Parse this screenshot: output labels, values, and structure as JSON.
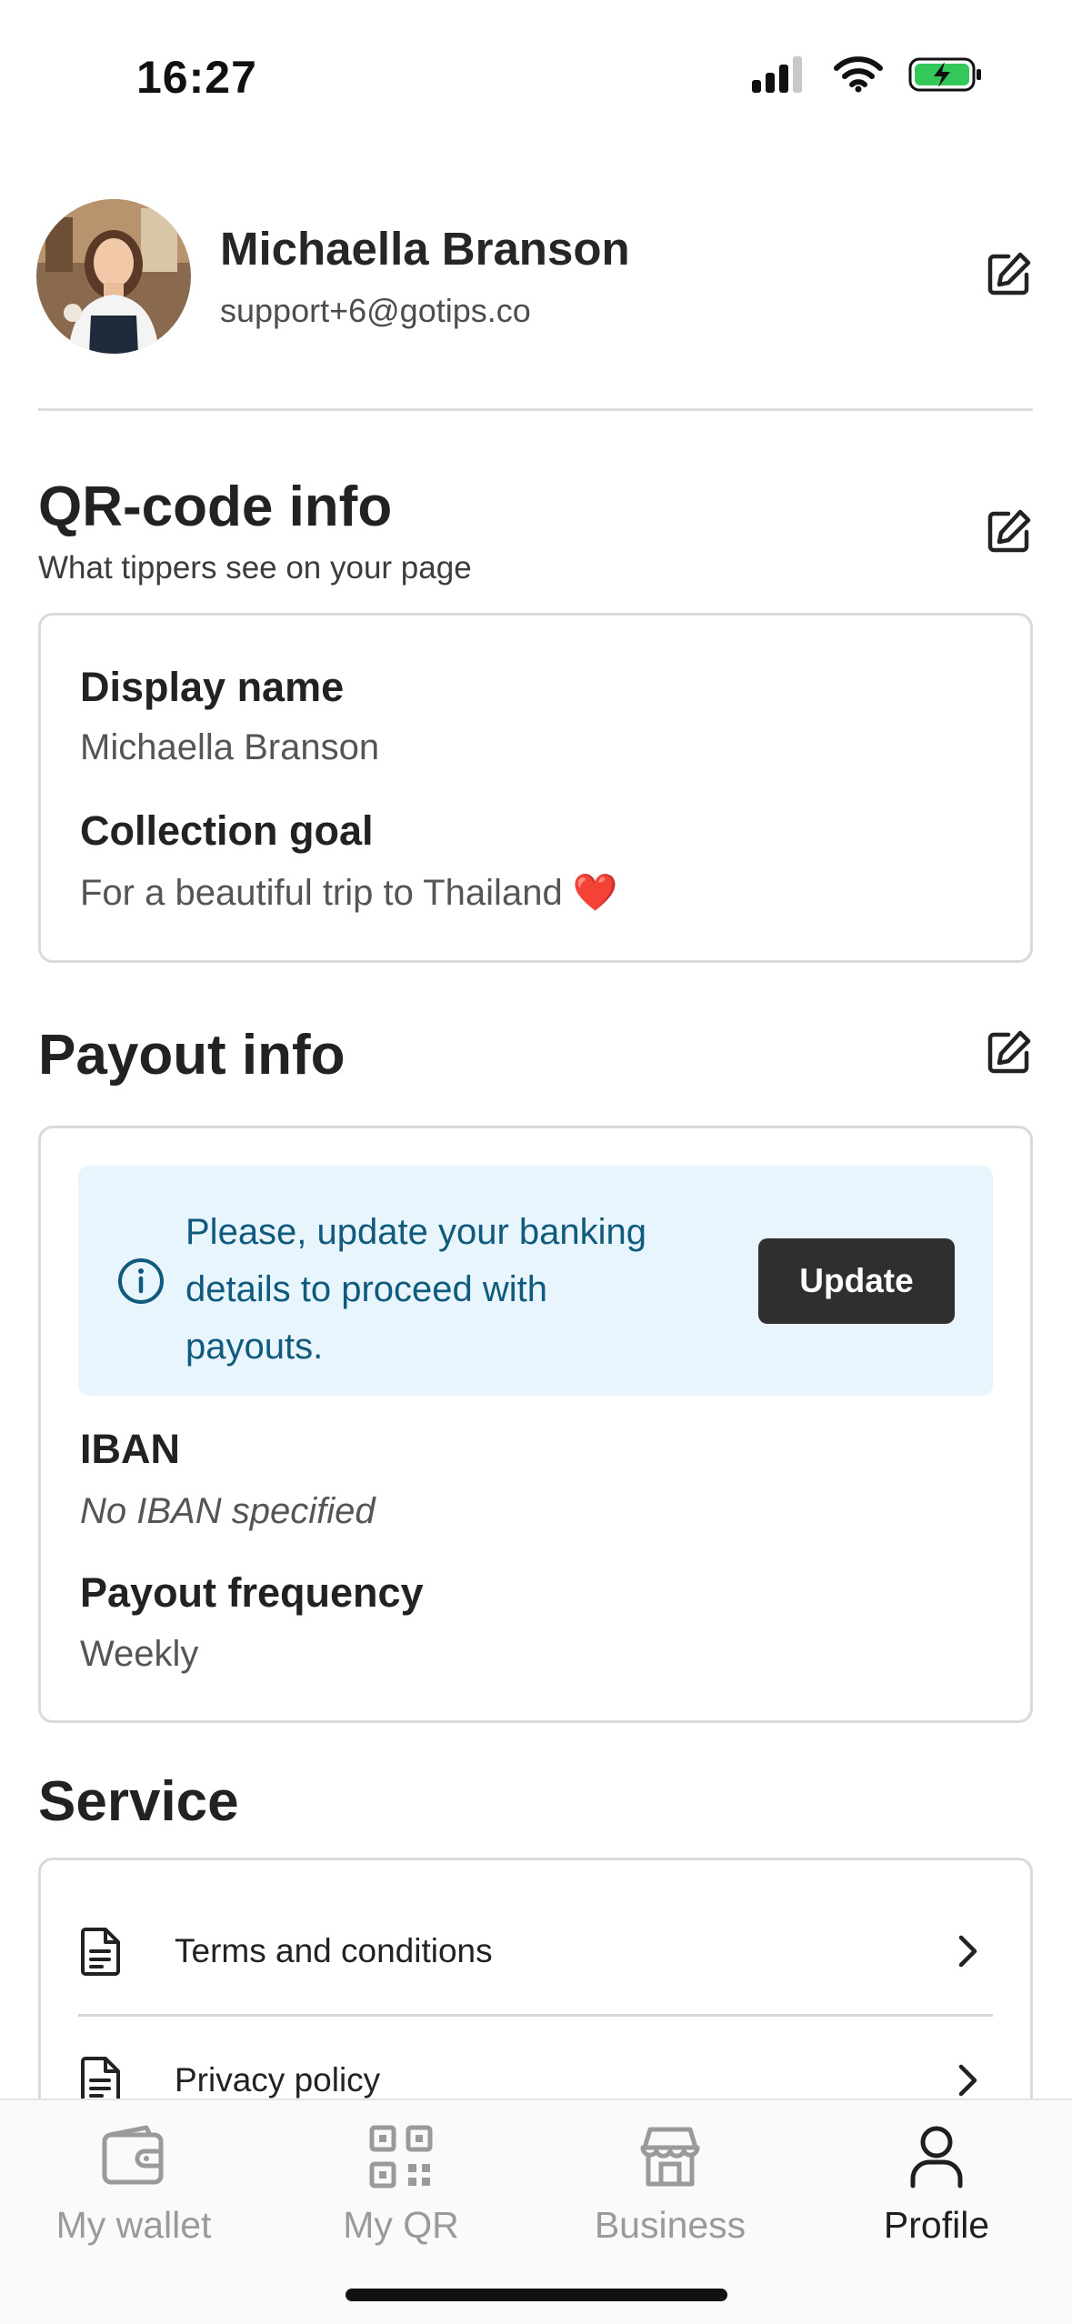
{
  "status_bar": {
    "time": "16:27"
  },
  "profile": {
    "name": "Michaella Branson",
    "email": "support+6@gotips.co"
  },
  "qr_section": {
    "title": "QR-code info",
    "subtitle": "What tippers see on your page",
    "display_name_label": "Display name",
    "display_name_value": "Michaella Branson",
    "goal_label": "Collection goal",
    "goal_value": "For a beautiful trip to Thailand ❤️"
  },
  "payout_section": {
    "title": "Payout info",
    "alert_text": "Please, update your banking details to proceed with payouts.",
    "update_button": "Update",
    "iban_label": "IBAN",
    "iban_value": "No IBAN specified",
    "frequency_label": "Payout frequency",
    "frequency_value": "Weekly"
  },
  "service_section": {
    "title": "Service",
    "items": [
      {
        "label": "Terms and conditions"
      },
      {
        "label": "Privacy policy"
      }
    ]
  },
  "tabbar": {
    "tabs": [
      {
        "label": "My wallet",
        "icon": "wallet-icon",
        "active": false
      },
      {
        "label": "My QR",
        "icon": "qr-code-icon",
        "active": false
      },
      {
        "label": "Business",
        "icon": "store-icon",
        "active": false
      },
      {
        "label": "Profile",
        "icon": "person-icon",
        "active": true
      }
    ]
  },
  "colors": {
    "alert_background": "#e8f5fc",
    "alert_text": "#0f5a7d",
    "button_background": "#2f2f2f",
    "battery_fill": "#34c759",
    "tab_inactive": "#9a9a9a",
    "tab_active": "#1f1f1f"
  }
}
